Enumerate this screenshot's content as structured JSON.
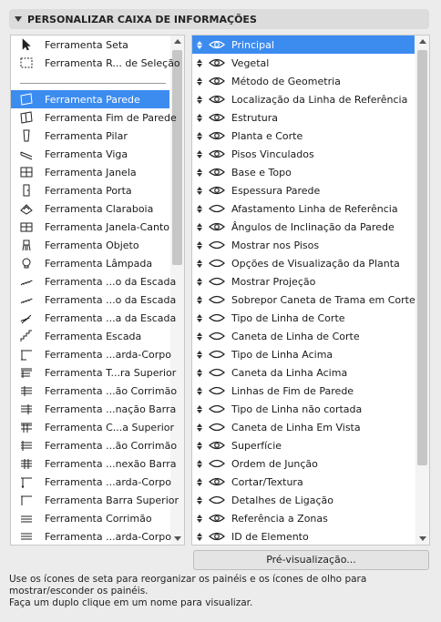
{
  "header": {
    "title": "PERSONALIZAR CAIXA DE INFORMAÇÕES"
  },
  "tools": [
    {
      "label": "Ferramenta Seta",
      "icon": "arrow-icon",
      "selected": false
    },
    {
      "label": "Ferramenta R... de Seleção",
      "icon": "marquee-icon",
      "selected": false
    },
    {
      "label": "Ferramenta Parede",
      "icon": "wall-icon",
      "selected": true
    },
    {
      "label": "Ferramenta Fim de Parede",
      "icon": "wall-end-icon",
      "selected": false
    },
    {
      "label": "Ferramenta Pilar",
      "icon": "column-icon",
      "selected": false
    },
    {
      "label": "Ferramenta Viga",
      "icon": "beam-icon",
      "selected": false
    },
    {
      "label": "Ferramenta Janela",
      "icon": "window-icon",
      "selected": false
    },
    {
      "label": "Ferramenta Porta",
      "icon": "door-icon",
      "selected": false
    },
    {
      "label": "Ferramenta Claraboia",
      "icon": "skylight-icon",
      "selected": false
    },
    {
      "label": "Ferramenta Janela-Canto",
      "icon": "corner-window-icon",
      "selected": false
    },
    {
      "label": "Ferramenta Objeto",
      "icon": "object-icon",
      "selected": false
    },
    {
      "label": "Ferramenta Lâmpada",
      "icon": "lamp-icon",
      "selected": false
    },
    {
      "label": "Ferramenta ...o da Escada",
      "icon": "stair-tread-icon",
      "selected": false
    },
    {
      "label": "Ferramenta ...o da Escada",
      "icon": "stair-riser-icon",
      "selected": false
    },
    {
      "label": "Ferramenta ...a da Escada",
      "icon": "stair-structure-icon",
      "selected": false
    },
    {
      "label": "Ferramenta Escada",
      "icon": "stair-icon",
      "selected": false
    },
    {
      "label": "Ferramenta ...arda-Corpo",
      "icon": "railing-icon",
      "selected": false
    },
    {
      "label": "Ferramenta T...ra Superior",
      "icon": "toprail-icon",
      "selected": false
    },
    {
      "label": "Ferramenta ...ão Corrimão",
      "icon": "handrail-post-icon",
      "selected": false
    },
    {
      "label": "Ferramenta ...nação Barra",
      "icon": "baluster-icon",
      "selected": false
    },
    {
      "label": "Ferramenta C...a Superior",
      "icon": "toprail-end-icon",
      "selected": false
    },
    {
      "label": "Ferramenta ...ão Corrimão",
      "icon": "handrail-end-icon",
      "selected": false
    },
    {
      "label": "Ferramenta ...nexão Barra",
      "icon": "rail-connection-icon",
      "selected": false
    },
    {
      "label": "Ferramenta ...arda-Corpo",
      "icon": "railing-post-icon",
      "selected": false
    },
    {
      "label": "Ferramenta Barra Superior",
      "icon": "top-bar-icon",
      "selected": false
    },
    {
      "label": "Ferramenta Corrimão",
      "icon": "handrail-icon",
      "selected": false
    },
    {
      "label": "Ferramenta ...arda-Corpo",
      "icon": "railing-panel-icon",
      "selected": false
    }
  ],
  "panels": [
    {
      "label": "Principal",
      "selected": true,
      "eye": "open"
    },
    {
      "label": "Vegetal",
      "selected": false,
      "eye": "open"
    },
    {
      "label": "Método de Geometria",
      "selected": false,
      "eye": "open"
    },
    {
      "label": "Localização da Linha de Referência",
      "selected": false,
      "eye": "open"
    },
    {
      "label": "Estrutura",
      "selected": false,
      "eye": "open"
    },
    {
      "label": "Planta e Corte",
      "selected": false,
      "eye": "open"
    },
    {
      "label": "Pisos Vinculados",
      "selected": false,
      "eye": "open"
    },
    {
      "label": "Base e Topo",
      "selected": false,
      "eye": "open"
    },
    {
      "label": "Espessura Parede",
      "selected": false,
      "eye": "open"
    },
    {
      "label": "Afastamento Linha de Referência",
      "selected": false,
      "eye": "closed"
    },
    {
      "label": "Ângulos de Inclinação da Parede",
      "selected": false,
      "eye": "open"
    },
    {
      "label": "Mostrar nos Pisos",
      "selected": false,
      "eye": "closed"
    },
    {
      "label": "Opções de Visualização da Planta",
      "selected": false,
      "eye": "closed"
    },
    {
      "label": "Mostrar Projeção",
      "selected": false,
      "eye": "closed"
    },
    {
      "label": "Sobrepor Caneta de Trama em Corte",
      "selected": false,
      "eye": "closed"
    },
    {
      "label": "Tipo de Linha de Corte",
      "selected": false,
      "eye": "closed"
    },
    {
      "label": "Caneta de Linha de Corte",
      "selected": false,
      "eye": "closed"
    },
    {
      "label": "Tipo de Linha Acima",
      "selected": false,
      "eye": "closed"
    },
    {
      "label": "Caneta da Linha Acima",
      "selected": false,
      "eye": "closed"
    },
    {
      "label": "Linhas de Fim de Parede",
      "selected": false,
      "eye": "closed"
    },
    {
      "label": "Tipo de Linha não cortada",
      "selected": false,
      "eye": "closed"
    },
    {
      "label": "Caneta de Linha Em Vista",
      "selected": false,
      "eye": "closed"
    },
    {
      "label": "Superfície",
      "selected": false,
      "eye": "open"
    },
    {
      "label": "Ordem de Junção",
      "selected": false,
      "eye": "closed"
    },
    {
      "label": "Cortar/Textura",
      "selected": false,
      "eye": "open"
    },
    {
      "label": "Detalhes de Ligação",
      "selected": false,
      "eye": "closed"
    },
    {
      "label": "Referência a Zonas",
      "selected": false,
      "eye": "open"
    },
    {
      "label": "ID de Elemento",
      "selected": false,
      "eye": "open"
    }
  ],
  "preview_button": "Pré-visualização...",
  "help": [
    "Use os ícones de seta para reorganizar os painéis e os ícones de olho para",
    "mostrar/esconder os painéis.",
    "Faça um duplo clique em um nome para visualizar."
  ],
  "colors": {
    "selection": "#3c8cf0",
    "background": "#ececec"
  }
}
